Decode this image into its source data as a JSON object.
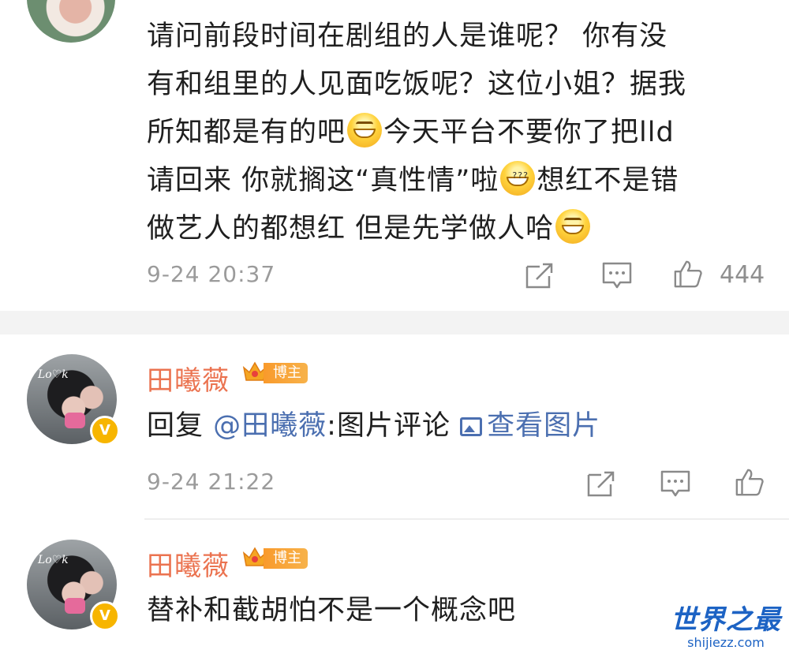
{
  "comments": [
    {
      "text_lines": [
        "请问前段时间在剧组的人是谁呢？ 你有没",
        "有和组里的人见面吃饭呢？这位小姐？据我",
        "所知都是有的吧",
        "今天平台不要你了把lld",
        "请回来 你就搁这“真性情”啦",
        "想红不是错",
        "做艺人的都想红 但是先学做人哈"
      ],
      "time": "9-24 20:37",
      "likes": "444"
    },
    {
      "name": "田曦薇",
      "badge": "博主",
      "verified_mark": "V",
      "reply_prefix": "回复",
      "mention": "@田曦薇",
      "reply_text": ":图片评论",
      "pic_link": "查看图片",
      "time": "9-24 21:22"
    },
    {
      "name": "田曦薇",
      "badge": "博主",
      "verified_mark": "V",
      "text": "替补和截胡怕不是一个概念吧"
    }
  ],
  "avatar_scribble": "Lo♡k",
  "watermark": {
    "main": "世界之最",
    "sub": "shijiezz.com"
  },
  "colors": {
    "name": "#eb7350",
    "link": "#4b6fb0",
    "badge": "#f7b500",
    "watermark": "#1d63c4"
  },
  "icons": [
    "share-icon",
    "comment-icon",
    "like-icon",
    "image-icon",
    "crown-icon",
    "grin-emoji",
    "sweat-emoji"
  ]
}
